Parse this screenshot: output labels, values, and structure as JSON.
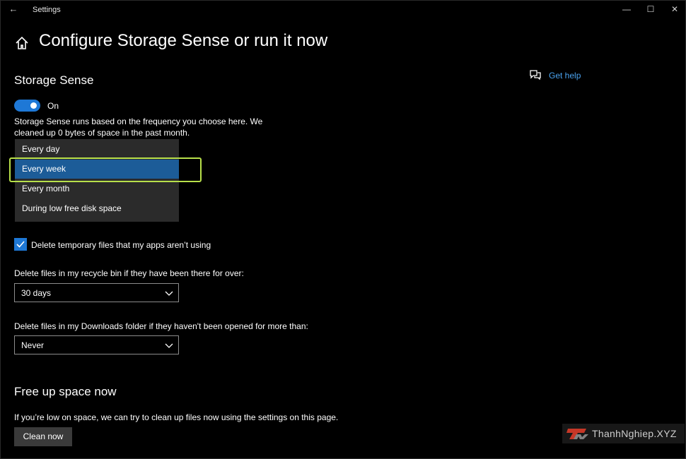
{
  "window": {
    "title": "Settings",
    "back_glyph": "←",
    "minimize_glyph": "—",
    "maximize_glyph": "☐",
    "close_glyph": "✕"
  },
  "page": {
    "title": "Configure Storage Sense or run it now"
  },
  "help": {
    "label": "Get help",
    "icon": "chat-help-icon"
  },
  "storage_sense": {
    "title": "Storage Sense",
    "toggle_label": "On",
    "toggle_on": true,
    "description_line1": "Storage Sense runs based on the frequency you choose here. We",
    "description_line2": "cleaned up 0 bytes of space in the past month."
  },
  "run_frequency": {
    "options": [
      "Every day",
      "Every week",
      "Every month",
      "During low free disk space"
    ],
    "selected_index": 1
  },
  "temp_files": {
    "checked": true,
    "label": "Delete temporary files that my apps aren’t using"
  },
  "recycle_bin": {
    "label": "Delete files in my recycle bin if they have been there for over:",
    "value": "30 days"
  },
  "downloads": {
    "label": "Delete files in my Downloads folder if they haven't been opened for more than:",
    "value": "Never"
  },
  "free_up": {
    "title": "Free up space now",
    "description": "If you’re low on space, we can try to clean up files now using the settings on this page.",
    "button_label": "Clean now"
  },
  "watermark": {
    "logo_text": "TN",
    "text": "ThanhNghiep.XYZ"
  },
  "colors": {
    "accent": "#1e78d6",
    "highlight": "#b8e04a",
    "link": "#4aa3f0",
    "selected_item": "#1c5c98"
  }
}
